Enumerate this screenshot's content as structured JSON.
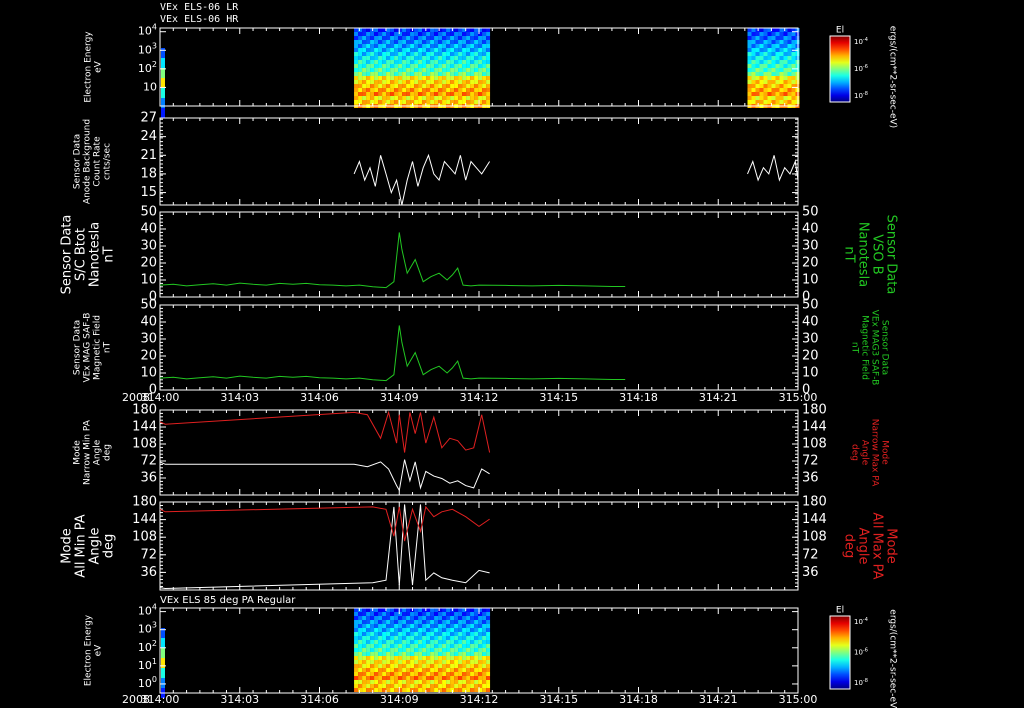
{
  "header": {
    "line1": "VEx ELS-06 LR",
    "line2": "VEx ELS-06 HR"
  },
  "colors": {
    "background": "#000000",
    "axes": "#ffffff",
    "green": "#22c722",
    "red": "#e02020",
    "white": "#ffffff"
  },
  "time_axis": {
    "year": "2008",
    "ticks": [
      "314:00",
      "314:03",
      "314:06",
      "314:09",
      "314:12",
      "314:15",
      "314:18",
      "314:21",
      "315:00"
    ],
    "range_hours": [
      0,
      24
    ]
  },
  "chart_data": [
    {
      "id": "els_lr_spectrogram",
      "type": "heatmap",
      "title": "",
      "ylabel": [
        "Electron Energy",
        "eV"
      ],
      "yticks": [
        "10^4",
        "10^3",
        "10^2",
        "10"
      ],
      "ylim_log10": [
        0,
        4.2
      ],
      "data_intervals_hours": [
        [
          7.3,
          12.4
        ],
        [
          22.1,
          24.0
        ]
      ],
      "colorbar": {
        "label": "El",
        "ticks": [
          "10^-4",
          "10^-6",
          "10^-8"
        ],
        "unit": "ergs/(cm**2-sr-sec-eV)"
      }
    },
    {
      "id": "anode_background",
      "type": "line",
      "ylabel": [
        "Sensor Data",
        "Anode Background",
        "Count Rate",
        "cnts/sec"
      ],
      "yticks": [
        15,
        18,
        21,
        24,
        27
      ],
      "ylim": [
        13,
        27
      ],
      "series": [
        {
          "color": "#ffffff",
          "x": [
            7.3,
            7.5,
            7.7,
            7.9,
            8.1,
            8.3,
            8.5,
            8.7,
            8.9,
            9.1,
            9.3,
            9.5,
            9.7,
            9.9,
            10.1,
            10.3,
            10.5,
            10.7,
            10.9,
            11.1,
            11.3,
            11.5,
            11.7,
            11.9,
            12.1,
            12.4
          ],
          "y": [
            18,
            20,
            17,
            19,
            16,
            21,
            18,
            15,
            17,
            13,
            17,
            20,
            16,
            19,
            21,
            18,
            17,
            20,
            19,
            18,
            21,
            17,
            20,
            19,
            18,
            20
          ]
        },
        {
          "color": "#ffffff",
          "x": [
            22.1,
            22.3,
            22.5,
            22.7,
            22.9,
            23.1,
            23.3,
            23.5,
            23.7,
            23.9,
            24.0
          ],
          "y": [
            18,
            20,
            17,
            19,
            18,
            21,
            17,
            19,
            18,
            20,
            17
          ]
        }
      ]
    },
    {
      "id": "sc_btot",
      "type": "line",
      "ylabel": [
        "Sensor Data",
        "S/C Btot",
        "Nanotesla",
        "nT"
      ],
      "ylabel_right": [
        "Sensor Data",
        "VSO B",
        "Nanotesla",
        "nT"
      ],
      "yticks": [
        0,
        10,
        20,
        30,
        40,
        50
      ],
      "ylim": [
        0,
        50
      ],
      "series": [
        {
          "color": "#22c722",
          "x": [
            0,
            0.5,
            1,
            1.5,
            2,
            2.5,
            3,
            3.5,
            4,
            4.5,
            5,
            5.5,
            6,
            6.5,
            7,
            7.5,
            8,
            8.5,
            8.8,
            9.0,
            9.1,
            9.3,
            9.6,
            9.9,
            10.2,
            10.5,
            10.8,
            11.0,
            11.2,
            11.4,
            11.7,
            12,
            13,
            14,
            15,
            16,
            17,
            17.5
          ],
          "y": [
            7,
            7.5,
            6.5,
            7.2,
            7.8,
            7,
            8.2,
            7.5,
            7,
            8,
            7.5,
            8,
            7.2,
            7,
            6.5,
            7,
            6,
            5.5,
            9,
            38,
            28,
            14,
            22,
            9,
            12,
            14,
            10,
            13,
            17,
            7,
            6.5,
            7,
            6.8,
            6.5,
            6.8,
            6.5,
            6.2,
            6.2
          ]
        }
      ]
    },
    {
      "id": "mag_saf_b",
      "type": "line",
      "ylabel": [
        "Sensor Data",
        "VEx MAG SAF-B",
        "Magnetic Field",
        "nT"
      ],
      "ylabel_right": [
        "Sensor Data",
        "VEx MAG3 SAF-B",
        "Magnetic Field",
        "nT"
      ],
      "yticks": [
        0,
        10,
        20,
        30,
        40,
        50
      ],
      "ylim": [
        0,
        50
      ],
      "series": [
        {
          "color": "#22c722",
          "x": [
            0,
            0.5,
            1,
            1.5,
            2,
            2.5,
            3,
            3.5,
            4,
            4.5,
            5,
            5.5,
            6,
            6.5,
            7,
            7.5,
            8,
            8.5,
            8.8,
            9.0,
            9.1,
            9.3,
            9.6,
            9.9,
            10.2,
            10.5,
            10.8,
            11.0,
            11.2,
            11.4,
            11.7,
            12,
            13,
            14,
            15,
            16,
            17,
            17.5
          ],
          "y": [
            7,
            7.5,
            6.5,
            7.2,
            7.8,
            7,
            8.2,
            7.5,
            7,
            8,
            7.5,
            8,
            7.2,
            7,
            6.5,
            7,
            6,
            5.5,
            9,
            38,
            28,
            14,
            22,
            9,
            12,
            14,
            10,
            13,
            17,
            7,
            6.5,
            7,
            6.8,
            6.5,
            6.8,
            6.5,
            6.2,
            6.2
          ]
        }
      ]
    },
    {
      "id": "narrow_pa",
      "type": "line",
      "ylabel": [
        "Mode",
        "Narrow Min PA",
        "Angle",
        "deg"
      ],
      "ylabel_right": [
        "Mode",
        "Narrow Max PA",
        "Angle",
        "deg"
      ],
      "yticks": [
        36,
        72,
        108,
        144,
        180
      ],
      "ylim": [
        0,
        180
      ],
      "series": [
        {
          "name": "min",
          "color": "#ffffff",
          "x": [
            0,
            0.2,
            7.3,
            7.8,
            8.3,
            8.6,
            8.9,
            9.0,
            9.2,
            9.4,
            9.6,
            9.8,
            10.0,
            10.3,
            10.6,
            10.9,
            11.2,
            11.5,
            11.8,
            12.1,
            12.4
          ],
          "y": [
            70,
            65,
            65,
            60,
            70,
            55,
            20,
            10,
            75,
            30,
            70,
            15,
            50,
            40,
            35,
            25,
            30,
            20,
            15,
            55,
            45
          ]
        },
        {
          "name": "max",
          "color": "#e02020",
          "x": [
            0,
            0.2,
            7.3,
            7.8,
            8.3,
            8.6,
            8.9,
            9.0,
            9.2,
            9.4,
            9.6,
            9.8,
            10.0,
            10.3,
            10.6,
            10.9,
            11.2,
            11.5,
            11.8,
            12.1,
            12.4
          ],
          "y": [
            155,
            150,
            175,
            170,
            120,
            175,
            110,
            170,
            90,
            175,
            130,
            175,
            110,
            165,
            100,
            120,
            115,
            95,
            100,
            170,
            90
          ]
        }
      ]
    },
    {
      "id": "all_pa",
      "type": "line",
      "ylabel": [
        "Mode",
        "All Min PA",
        "Angle",
        "deg"
      ],
      "ylabel_right": [
        "Mode",
        "All Max PA",
        "Angle",
        "deg"
      ],
      "yticks": [
        36,
        72,
        108,
        144,
        180
      ],
      "ylim": [
        0,
        180
      ],
      "series": [
        {
          "name": "min",
          "color": "#ffffff",
          "x": [
            0,
            0.2,
            8.0,
            8.5,
            8.8,
            9.0,
            9.2,
            9.5,
            9.8,
            10.0,
            10.3,
            10.6,
            11.0,
            11.5,
            12.0,
            12.4
          ],
          "y": [
            5,
            3,
            15,
            20,
            170,
            10,
            175,
            10,
            175,
            20,
            35,
            25,
            20,
            15,
            40,
            35
          ]
        },
        {
          "name": "max",
          "color": "#e02020",
          "x": [
            0,
            0.2,
            8.0,
            8.5,
            8.8,
            9.0,
            9.2,
            9.5,
            9.8,
            10.0,
            10.3,
            10.6,
            11.0,
            11.5,
            12.0,
            12.4
          ],
          "y": [
            165,
            160,
            170,
            165,
            110,
            170,
            100,
            165,
            120,
            170,
            150,
            160,
            165,
            150,
            130,
            145
          ]
        }
      ]
    },
    {
      "id": "els_85deg_spectrogram",
      "type": "heatmap",
      "title": "VEx ELS 85 deg PA Regular",
      "ylabel": [
        "Electron Energy",
        "eV"
      ],
      "yticks": [
        "10^4",
        "10^3",
        "10^2",
        "10^1",
        "10^0"
      ],
      "ylim_log10": [
        -0.5,
        4.2
      ],
      "data_intervals_hours": [
        [
          7.3,
          12.4
        ]
      ],
      "colorbar": {
        "label": "El",
        "ticks": [
          "10^-4",
          "10^-6",
          "10^-8"
        ],
        "unit": "ergs/(cm**2-sr-sec-eV)"
      }
    }
  ]
}
